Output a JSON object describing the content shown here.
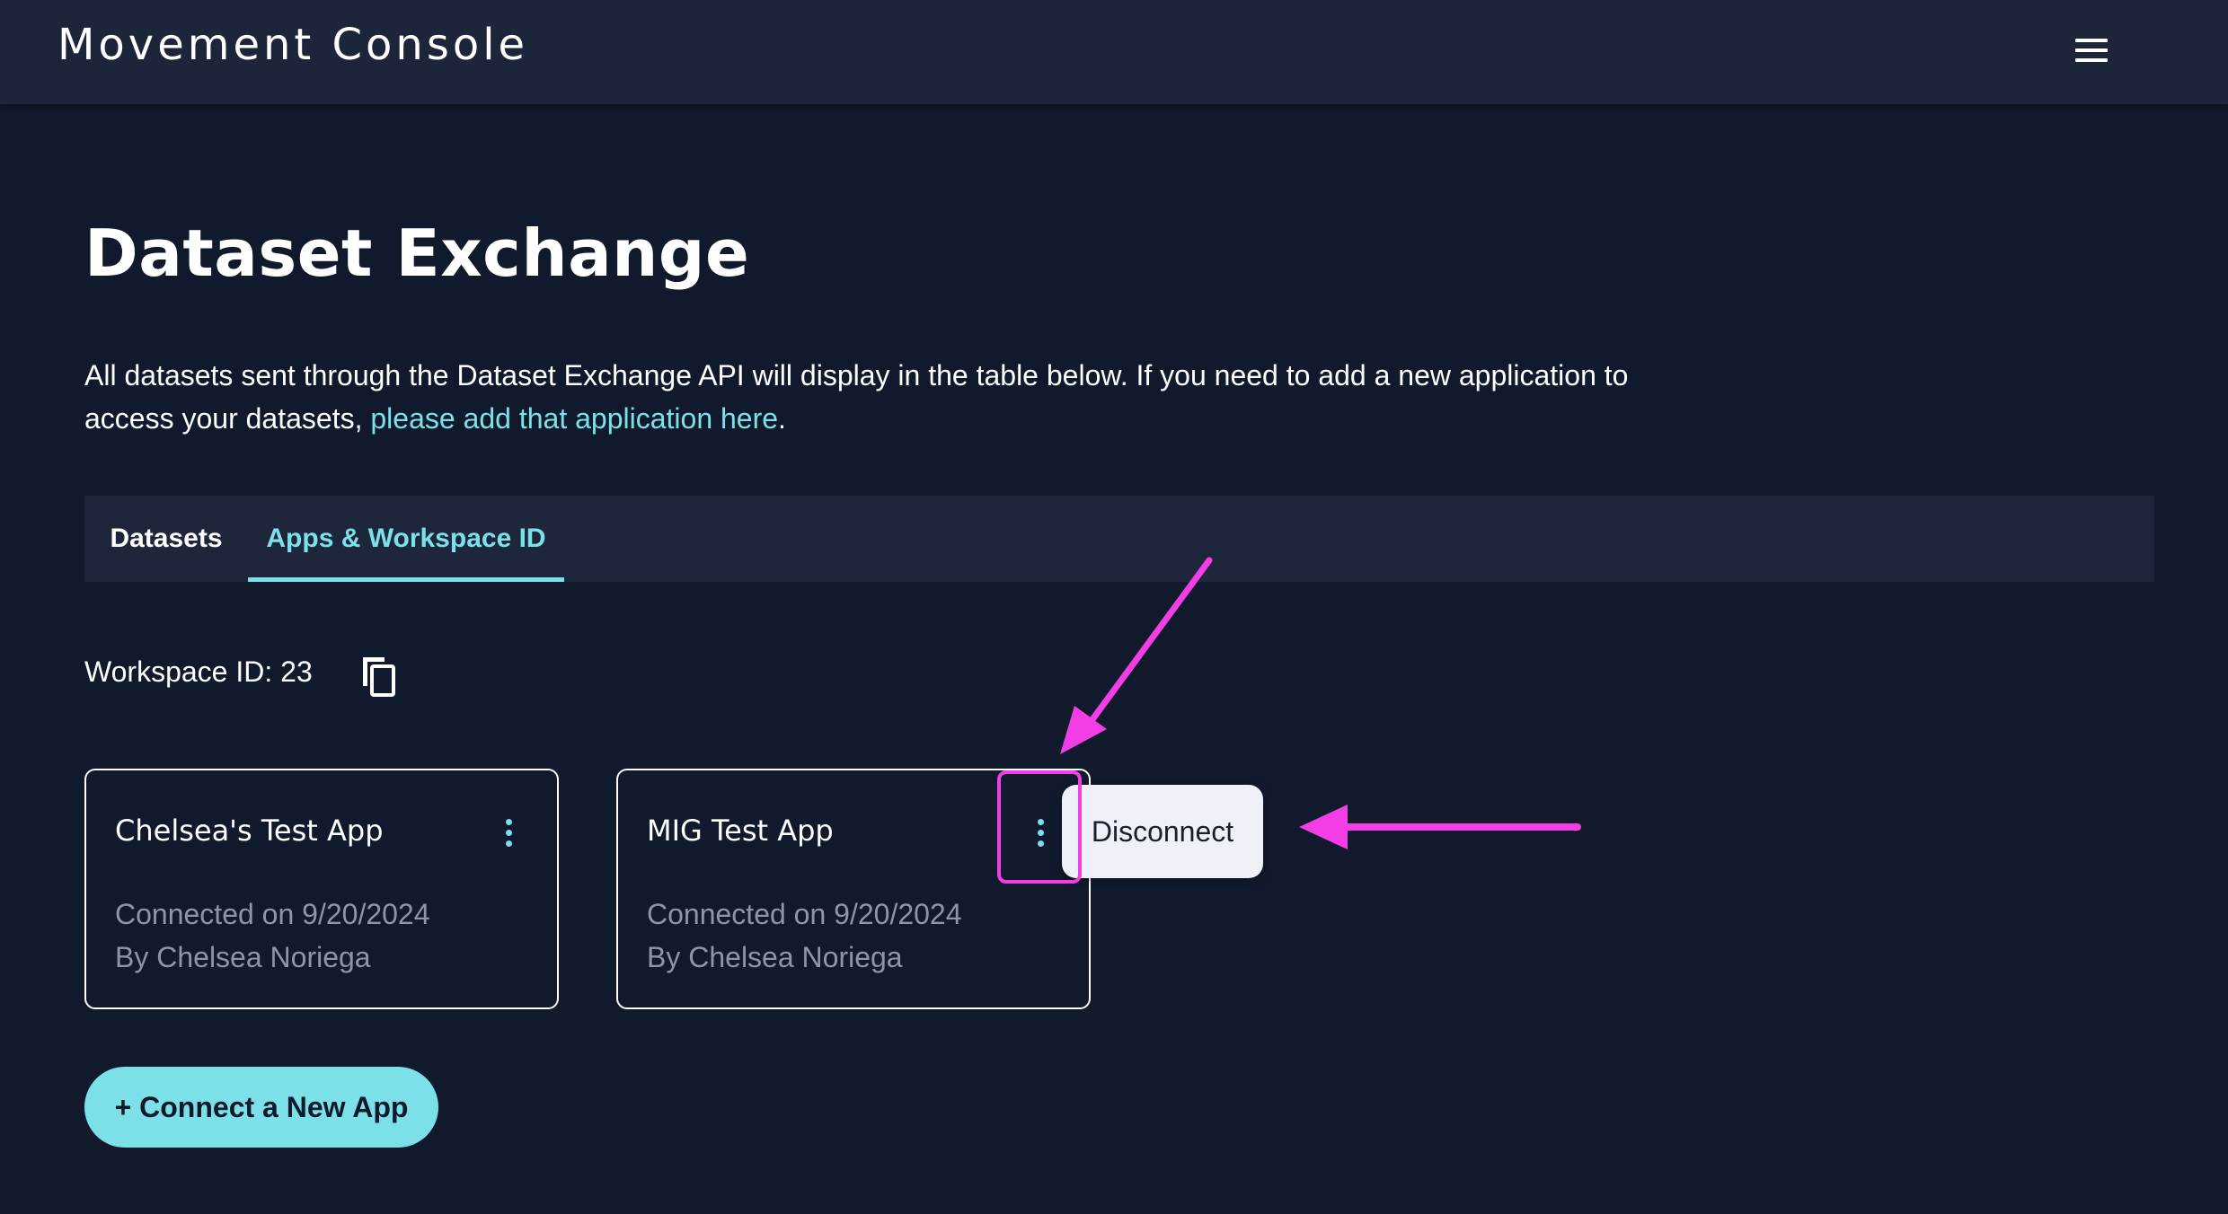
{
  "app": {
    "brand": "Movement Console"
  },
  "page": {
    "title": "Dataset Exchange",
    "intro_text": "All datasets sent through the Dataset Exchange API will display in the table below. If you need to add a new application to access your datasets, ",
    "intro_link": "please add that application here",
    "intro_end": "."
  },
  "tabs": [
    {
      "label": "Datasets",
      "active": false
    },
    {
      "label": "Apps & Workspace ID",
      "active": true
    }
  ],
  "workspace": {
    "label": "Workspace ID: 23"
  },
  "apps": [
    {
      "name": "Chelsea's Test App",
      "connected": "Connected on 9/20/2024",
      "by": "By Chelsea Noriega"
    },
    {
      "name": "MIG Test App",
      "connected": "Connected on 9/20/2024",
      "by": "By Chelsea Noriega"
    }
  ],
  "popover": {
    "label": "Disconnect"
  },
  "actions": {
    "connect_label": "+ Connect a New App"
  },
  "icons": {
    "menu": "hamburger-menu-icon",
    "copy": "copy-icon",
    "more": "vertical-dots-icon"
  },
  "colors": {
    "background": "#111a2c",
    "topbar": "#1c253a",
    "accent": "#7be0e7",
    "annotation": "#f33ee6"
  }
}
